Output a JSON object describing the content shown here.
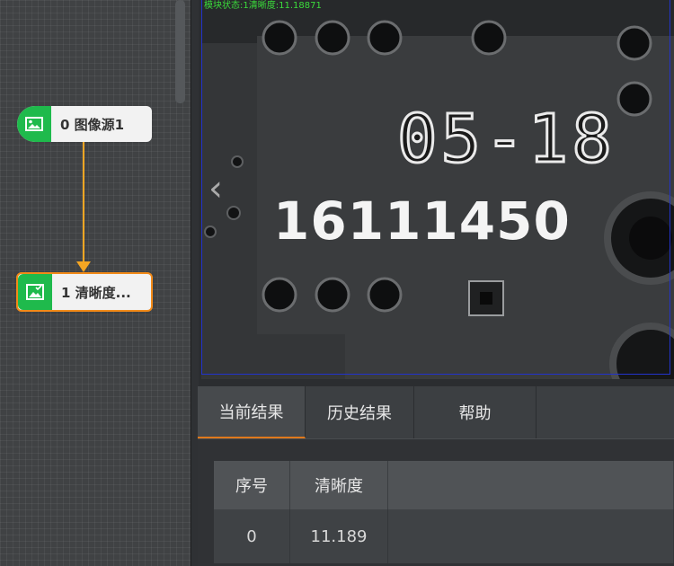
{
  "flow": {
    "nodes": [
      {
        "id": "0",
        "label": "0 图像源1",
        "icon": "image-icon"
      },
      {
        "id": "1",
        "label": "1 清晰度...",
        "icon": "image-check-icon"
      }
    ]
  },
  "viewer": {
    "status_text": "模块状态:1清晰度:11.18871",
    "nav_prev": "‹",
    "pcb_text_line1": "05-18",
    "pcb_text_line2": "16111450"
  },
  "tabs": [
    {
      "label": "当前结果",
      "active": true
    },
    {
      "label": "历史结果",
      "active": false
    },
    {
      "label": "帮助",
      "active": false
    }
  ],
  "results": {
    "headers": [
      "序号",
      "清晰度"
    ],
    "rows": [
      [
        "0",
        "11.189"
      ]
    ]
  },
  "colors": {
    "node_icon_bg": "#1fba4c",
    "connector": "#f5a623",
    "selected_border": "#f28a18",
    "active_tab_underline": "#e0791c",
    "roi_border": "#2233cc",
    "status_text": "#3bdc3b"
  }
}
